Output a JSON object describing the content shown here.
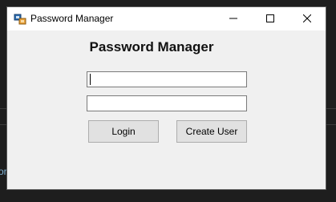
{
  "window": {
    "title": "Password Manager",
    "icon": "app-icon",
    "controls": {
      "minimize_icon": "minimize-icon",
      "maximize_icon": "maximize-icon",
      "close_icon": "close-icon"
    }
  },
  "form": {
    "heading": "Password Manager",
    "username": {
      "value": "",
      "placeholder": ""
    },
    "password": {
      "value": "",
      "placeholder": ""
    },
    "login_label": "Login",
    "create_user_label": "Create User"
  },
  "background": {
    "partial_text": "or"
  },
  "colors": {
    "window_bg": "#f0f0f0",
    "titlebar_bg": "#ffffff",
    "button_bg": "#e1e1e1",
    "desktop_bg": "#1e1e1e"
  }
}
